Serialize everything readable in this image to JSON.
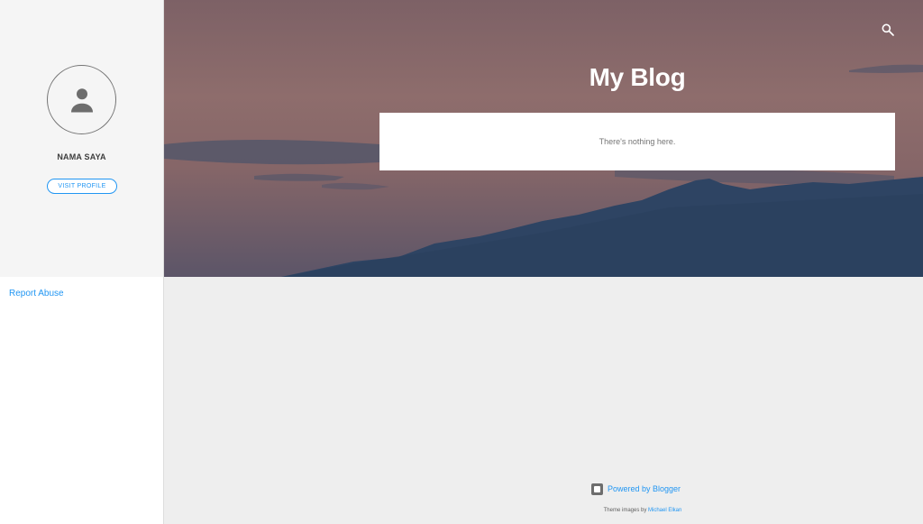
{
  "sidebar": {
    "profile_name": "NAMA SAYA",
    "visit_profile_label": "VISIT PROFILE",
    "report_abuse_label": "Report Abuse"
  },
  "header": {
    "blog_title": "My Blog",
    "search_icon": "search-icon"
  },
  "main": {
    "empty_message": "There's nothing here."
  },
  "footer": {
    "powered_by_label": "Powered by Blogger",
    "blogger_icon": "blogger-icon",
    "theme_images_prefix": "Theme images by",
    "theme_images_author": "Michael Elkan"
  },
  "colors": {
    "accent": "#2196f3",
    "sidebar_bg": "#f5f5f5",
    "page_bg": "#eeeeee",
    "mountain": "#2e4463"
  }
}
